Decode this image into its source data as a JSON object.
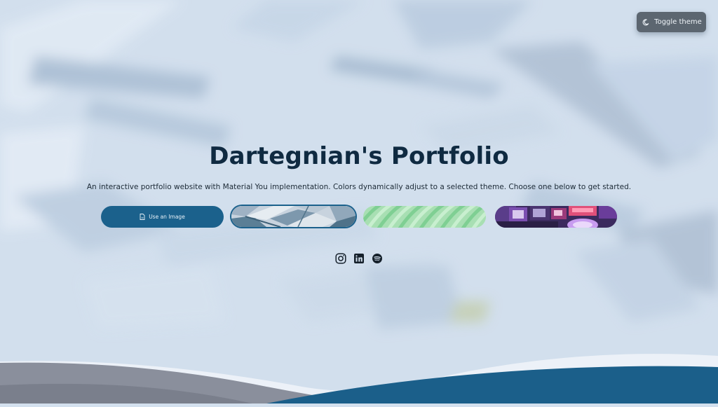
{
  "header": {
    "toggle_theme_label": "Toggle theme",
    "toggle_icon": "moon-icon"
  },
  "hero": {
    "title": "Dartegnian's Portfolio",
    "subtitle": "An interactive portfolio website with Material You implementation. Colors dynamically adjust to a selected theme. Choose one below to get started."
  },
  "theme_picker": {
    "use_image_label": "Use an Image",
    "use_image_icon": "file-image-icon",
    "swatches": [
      {
        "name": "glass-architecture",
        "selected": true
      },
      {
        "name": "green-waves",
        "selected": false
      },
      {
        "name": "neon-arcade",
        "selected": false
      }
    ]
  },
  "social": [
    {
      "name": "instagram-icon"
    },
    {
      "name": "linkedin-icon"
    },
    {
      "name": "spotify-icon"
    }
  ],
  "colors": {
    "background": "#d3e0ee",
    "primary": "#1b618c",
    "title": "#0f2a41",
    "toggle_bg": "#5c6670",
    "wave_dark": "#1b5f8a",
    "wave_grey": "#8a8f9c"
  }
}
